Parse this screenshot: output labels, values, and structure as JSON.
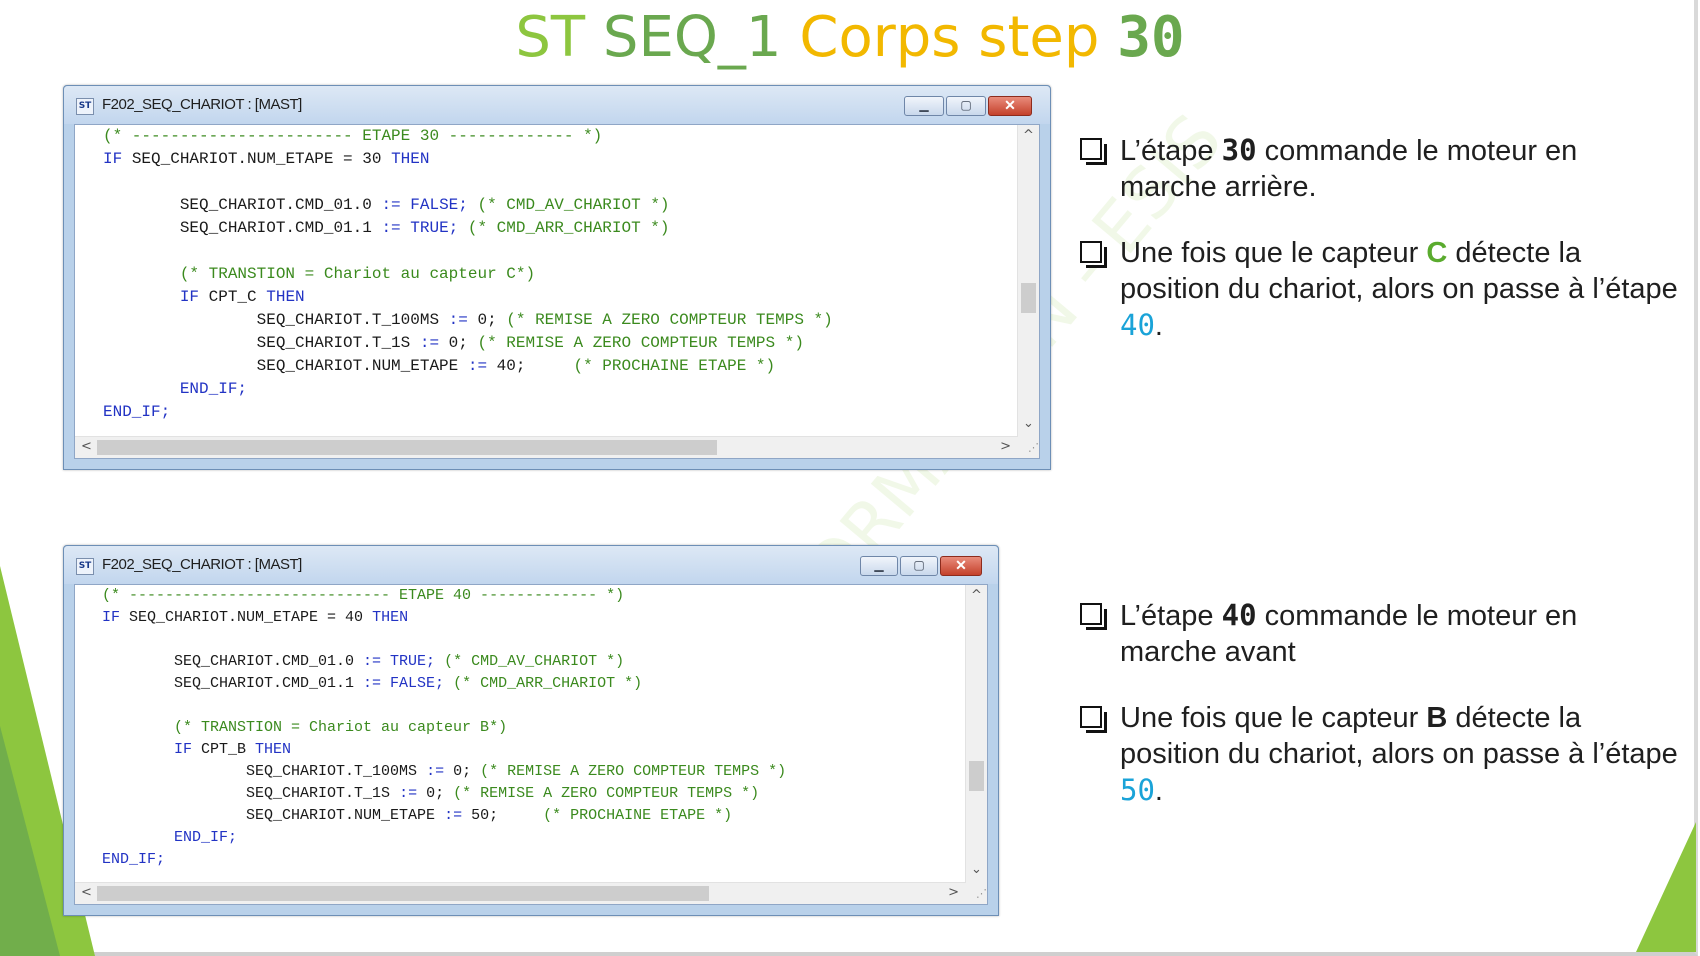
{
  "title": {
    "part1": "ST ",
    "part2": "SEQ_1 ",
    "part3": "Corps step ",
    "part4": "30"
  },
  "watermark": "FORMATION - ESIS",
  "windows": [
    {
      "title": "F202_SEQ_CHARIOT : [MAST]",
      "icon_text": "ST",
      "lines": [
        [
          [
            "cm",
            "(* ----------------------- ETAPE 30 ------------- *)"
          ]
        ],
        [
          [
            "kw",
            "IF "
          ],
          [
            "tx",
            "SEQ_CHARIOT.NUM_ETAPE = 30 "
          ],
          [
            "kw",
            "THEN"
          ]
        ],
        [
          [
            "tx",
            ""
          ]
        ],
        [
          [
            "tx",
            "        SEQ_CHARIOT.CMD_01.0 "
          ],
          [
            "kw",
            ":= FALSE;"
          ],
          [
            "tx",
            " "
          ],
          [
            "cm",
            "(* CMD_AV_CHARIOT *)"
          ]
        ],
        [
          [
            "tx",
            "        SEQ_CHARIOT.CMD_01.1 "
          ],
          [
            "kw",
            ":= TRUE;"
          ],
          [
            "tx",
            " "
          ],
          [
            "cm",
            "(* CMD_ARR_CHARIOT *)"
          ]
        ],
        [
          [
            "tx",
            ""
          ]
        ],
        [
          [
            "cm",
            "        (* TRANSTION = Chariot au capteur C*)"
          ]
        ],
        [
          [
            "kw",
            "        IF "
          ],
          [
            "tx",
            "CPT_C "
          ],
          [
            "kw",
            "THEN"
          ]
        ],
        [
          [
            "tx",
            "                SEQ_CHARIOT.T_100MS "
          ],
          [
            "kw",
            ":="
          ],
          [
            "tx",
            " 0; "
          ],
          [
            "cm",
            "(* REMISE A ZERO COMPTEUR TEMPS *)"
          ]
        ],
        [
          [
            "tx",
            "                SEQ_CHARIOT.T_1S "
          ],
          [
            "kw",
            ":="
          ],
          [
            "tx",
            " 0; "
          ],
          [
            "cm",
            "(* REMISE A ZERO COMPTEUR TEMPS *)"
          ]
        ],
        [
          [
            "tx",
            "                SEQ_CHARIOT.NUM_ETAPE "
          ],
          [
            "kw",
            ":="
          ],
          [
            "tx",
            " 40;     "
          ],
          [
            "cm",
            "(* PROCHAINE ETAPE *)"
          ]
        ],
        [
          [
            "kw",
            "        END_IF;"
          ]
        ],
        [
          [
            "kw",
            "END_IF;"
          ]
        ]
      ]
    },
    {
      "title": "F202_SEQ_CHARIOT : [MAST]",
      "icon_text": "ST",
      "lines": [
        [
          [
            "cm",
            "(* ----------------------------- ETAPE 40 ------------- *)"
          ]
        ],
        [
          [
            "kw",
            "IF "
          ],
          [
            "tx",
            "SEQ_CHARIOT.NUM_ETAPE = 40 "
          ],
          [
            "kw",
            "THEN"
          ]
        ],
        [
          [
            "tx",
            ""
          ]
        ],
        [
          [
            "tx",
            "        SEQ_CHARIOT.CMD_01.0 "
          ],
          [
            "kw",
            ":= TRUE;"
          ],
          [
            "tx",
            " "
          ],
          [
            "cm",
            "(* CMD_AV_CHARIOT *)"
          ]
        ],
        [
          [
            "tx",
            "        SEQ_CHARIOT.CMD_01.1 "
          ],
          [
            "kw",
            ":= FALSE;"
          ],
          [
            "tx",
            " "
          ],
          [
            "cm",
            "(* CMD_ARR_CHARIOT *)"
          ]
        ],
        [
          [
            "tx",
            ""
          ]
        ],
        [
          [
            "cm",
            "        (* TRANSTION = Chariot au capteur B*)"
          ]
        ],
        [
          [
            "kw",
            "        IF "
          ],
          [
            "tx",
            "CPT_B "
          ],
          [
            "kw",
            "THEN"
          ]
        ],
        [
          [
            "tx",
            "                SEQ_CHARIOT.T_100MS "
          ],
          [
            "kw",
            ":="
          ],
          [
            "tx",
            " 0; "
          ],
          [
            "cm",
            "(* REMISE A ZERO COMPTEUR TEMPS *)"
          ]
        ],
        [
          [
            "tx",
            "                SEQ_CHARIOT.T_1S "
          ],
          [
            "kw",
            ":="
          ],
          [
            "tx",
            " 0; "
          ],
          [
            "cm",
            "(* REMISE A ZERO COMPTEUR TEMPS *)"
          ]
        ],
        [
          [
            "tx",
            "                SEQ_CHARIOT.NUM_ETAPE "
          ],
          [
            "kw",
            ":="
          ],
          [
            "tx",
            " 50;     "
          ],
          [
            "cm",
            "(* PROCHAINE ETAPE *)"
          ]
        ],
        [
          [
            "kw",
            "        END_IF;"
          ]
        ],
        [
          [
            "kw",
            "END_IF;"
          ]
        ]
      ]
    }
  ],
  "bullets_top": {
    "b1": {
      "pre": "L’étape ",
      "num": "30",
      "post": " commande le moteur en marche arrière."
    },
    "b2": {
      "pre": "Une fois que le capteur ",
      "sensor": "C",
      "mid": " détecte la position du chariot, alors on passe à l’étape ",
      "next": "40",
      "end": "."
    }
  },
  "bullets_bottom": {
    "b1": {
      "pre": "L’étape ",
      "num": "40",
      "post": " commande le moteur en marche avant"
    },
    "b2": {
      "pre": "Une fois que le capteur ",
      "sensor": "B",
      "mid": " détecte la position du chariot, alors on passe à l’étape ",
      "next": "50",
      "end": "."
    }
  },
  "colors": {
    "comment": "#3b8a1e",
    "keyword": "#2233c4",
    "accent_green": "#8dc63f",
    "title_yellow": "#f2b800",
    "step_cyan": "#1aa3d8"
  }
}
